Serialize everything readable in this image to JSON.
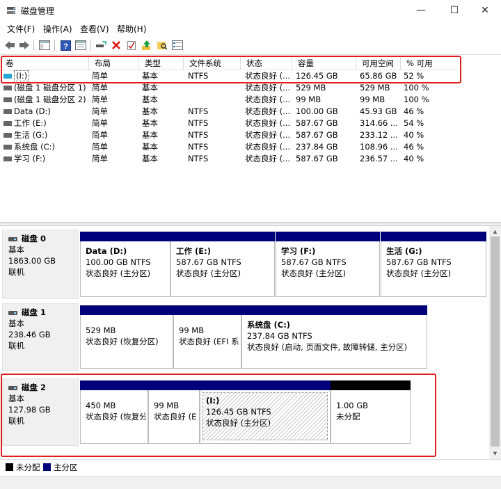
{
  "window": {
    "title": "磁盘管理",
    "minimize": "—",
    "maximize": "☐",
    "close": "✕"
  },
  "menu": [
    "文件(F)",
    "操作(A)",
    "查看(V)",
    "帮助(H)"
  ],
  "columns": [
    "卷",
    "布局",
    "类型",
    "文件系统",
    "状态",
    "容量",
    "可用空间",
    "% 可用"
  ],
  "volumes": [
    {
      "name": "(I:)",
      "layout": "简单",
      "type": "基本",
      "fs": "NTFS",
      "status": "状态良好 (...",
      "capacity": "126.45 GB",
      "free": "65.86 GB",
      "pct": "52 %"
    },
    {
      "name": "(磁盘 1 磁盘分区 1)",
      "layout": "简单",
      "type": "基本",
      "fs": "",
      "status": "状态良好 (...",
      "capacity": "529 MB",
      "free": "529 MB",
      "pct": "100 %"
    },
    {
      "name": "(磁盘 1 磁盘分区 2)",
      "layout": "简单",
      "type": "基本",
      "fs": "",
      "status": "状态良好 (...",
      "capacity": "99 MB",
      "free": "99 MB",
      "pct": "100 %"
    },
    {
      "name": "Data (D:)",
      "layout": "简单",
      "type": "基本",
      "fs": "NTFS",
      "status": "状态良好 (...",
      "capacity": "100.00 GB",
      "free": "45.93 GB",
      "pct": "46 %"
    },
    {
      "name": "工作 (E:)",
      "layout": "简单",
      "type": "基本",
      "fs": "NTFS",
      "status": "状态良好 (...",
      "capacity": "587.67 GB",
      "free": "314.66 ...",
      "pct": "54 %"
    },
    {
      "name": "生活 (G:)",
      "layout": "简单",
      "type": "基本",
      "fs": "NTFS",
      "status": "状态良好 (...",
      "capacity": "587.67 GB",
      "free": "233.12 ...",
      "pct": "40 %"
    },
    {
      "name": "系统盘 (C:)",
      "layout": "简单",
      "type": "基本",
      "fs": "NTFS",
      "status": "状态良好 (...",
      "capacity": "237.84 GB",
      "free": "108.96 ...",
      "pct": "46 %"
    },
    {
      "name": "学习 (F:)",
      "layout": "简单",
      "type": "基本",
      "fs": "NTFS",
      "status": "状态良好 (...",
      "capacity": "587.67 GB",
      "free": "236.57 ...",
      "pct": "40 %"
    }
  ],
  "disks": [
    {
      "name": "磁盘 0",
      "type": "基本",
      "size": "1863.00 GB",
      "state": "联机",
      "partitions": [
        {
          "title": "Data  (D:)",
          "line1": "100.00 GB NTFS",
          "line2": "状态良好 (主分区)"
        },
        {
          "title": "工作  (E:)",
          "line1": "587.67 GB NTFS",
          "line2": "状态良好 (主分区)"
        },
        {
          "title": "学习  (F:)",
          "line1": "587.67 GB NTFS",
          "line2": "状态良好 (主分区)"
        },
        {
          "title": "生活  (G:)",
          "line1": "587.67 GB NTFS",
          "line2": "状态良好 (主分区)"
        }
      ]
    },
    {
      "name": "磁盘 1",
      "type": "基本",
      "size": "238.46 GB",
      "state": "联机",
      "partitions": [
        {
          "title": "",
          "line1": "529 MB",
          "line2": "状态良好 (恢复分区)"
        },
        {
          "title": "",
          "line1": "99 MB",
          "line2": "状态良好 (EFI 系"
        },
        {
          "title": "系统盘  (C:)",
          "line1": "237.84 GB NTFS",
          "line2": "状态良好 (启动, 页面文件, 故障转储, 主分区)"
        }
      ]
    },
    {
      "name": "磁盘 2",
      "type": "基本",
      "size": "127.98 GB",
      "state": "联机",
      "partitions": [
        {
          "title": "",
          "line1": "450 MB",
          "line2": "状态良好 (恢复分"
        },
        {
          "title": "",
          "line1": "99 MB",
          "line2": "状态良好 (E"
        },
        {
          "title": "(I:)",
          "line1": "126.45 GB NTFS",
          "line2": "状态良好 (主分区)"
        },
        {
          "title": "",
          "line1": "1.00 GB",
          "line2": "未分配"
        }
      ]
    }
  ],
  "legend": {
    "unallocated": "未分配",
    "primary": "主分区"
  },
  "colors": {
    "primary": "#00007a",
    "unallocated": "#000000",
    "highlight": "#e02020",
    "volume_icon": "#2aa7d6"
  }
}
